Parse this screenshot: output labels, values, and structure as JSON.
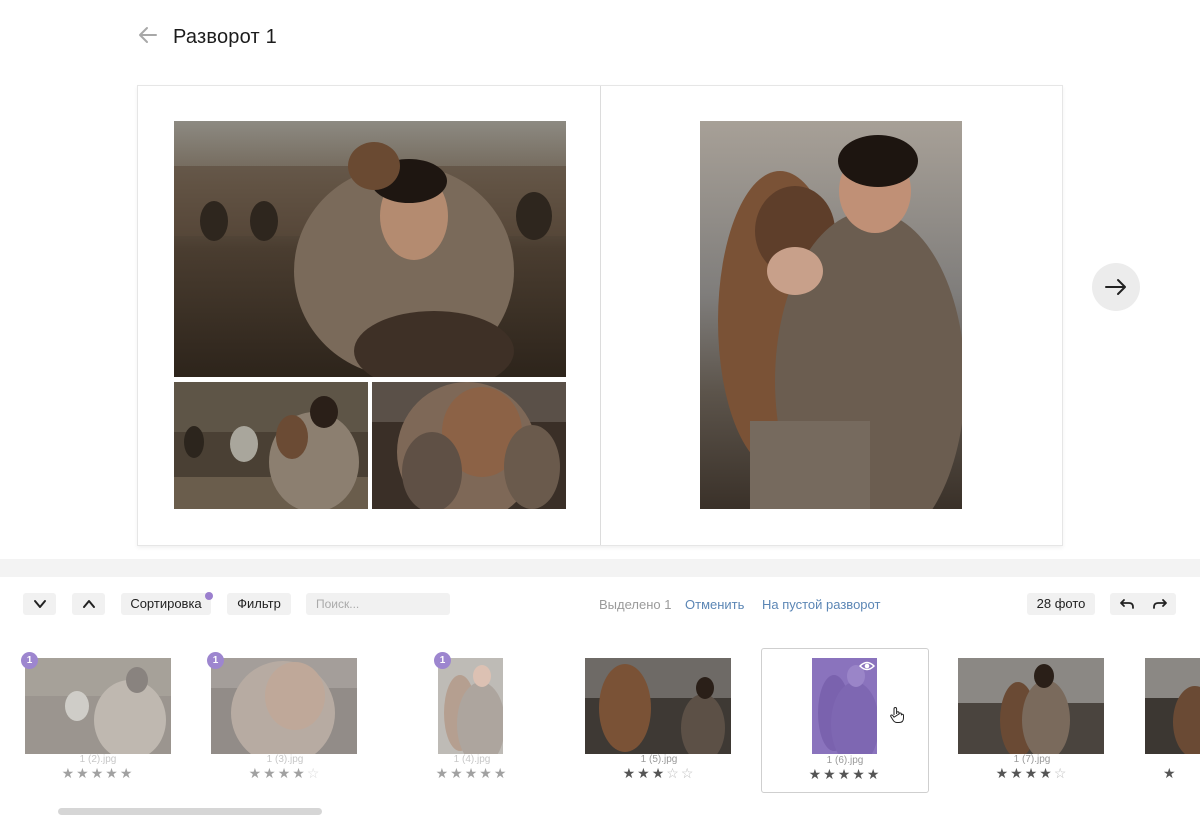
{
  "header": {
    "title": "Разворот 1",
    "back_icon": "arrow-left-icon"
  },
  "spread": {
    "next_icon": "arrow-right-icon"
  },
  "toolbar": {
    "collapse_icon": "chevron-down-icon",
    "expand_icon": "chevron-up-icon",
    "sort_label": "Сортировка",
    "filter_label": "Фильтр",
    "search_placeholder": "Поиск...",
    "selected_text": "Выделено 1",
    "cancel_label": "Отменить",
    "to_empty_spread_label": "На пустой разворот",
    "photo_count": "28 фото",
    "undo_icon": "undo-icon",
    "redo_icon": "redo-icon",
    "accent_color": "#9d86cf",
    "link_color": "#5b86b5"
  },
  "filmstrip": {
    "items": [
      {
        "name": "1 (2).jpg",
        "badge": "1",
        "rating": 5
      },
      {
        "name": "1 (3).jpg",
        "badge": "1",
        "rating": 4
      },
      {
        "name": "1 (4).jpg",
        "badge": "1",
        "rating": 5
      },
      {
        "name": "1 (5).jpg",
        "badge": "",
        "rating": 3
      },
      {
        "name": "1 (6).jpg",
        "badge": "",
        "rating": 5,
        "selected": true
      },
      {
        "name": "1 (7).jpg",
        "badge": "",
        "rating": 4
      }
    ],
    "max_rating": 5
  }
}
